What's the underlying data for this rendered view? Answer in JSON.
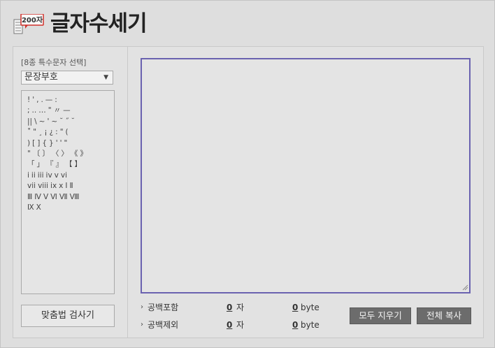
{
  "header": {
    "logo_text": "200자",
    "title": "글자수세기"
  },
  "sidebar": {
    "special_char_label": "[8종 특수문자 선택]",
    "category_select": {
      "selected": "문장부호",
      "arrow": "▼"
    },
    "char_rows": [
      [
        "!",
        "'",
        ",",
        ".",
        "—",
        ":"
      ],
      [
        ";",
        "..",
        "…",
        "\"",
        "〃",
        "—"
      ],
      [
        "||",
        "\\",
        "~",
        "'",
        "~",
        "˘",
        "˝",
        "˘"
      ],
      [
        "˚",
        "\"",
        "¸",
        "¡",
        "¿",
        ":",
        "\"",
        "("
      ],
      [
        ")",
        "[",
        "]",
        "{",
        "}",
        "'",
        "'",
        "\""
      ],
      [
        "\"",
        "〔",
        "〕",
        "〈",
        "〉",
        "《",
        "》"
      ],
      [
        "「",
        "」",
        "『",
        "』",
        "【",
        "】"
      ],
      [
        "i",
        "ii",
        "iii",
        "iv",
        "v",
        "vi"
      ],
      [
        "vii",
        "viii",
        "ix",
        "x",
        "Ⅰ",
        "Ⅱ"
      ],
      [
        "Ⅲ",
        "Ⅳ",
        "Ⅴ",
        "Ⅵ",
        "Ⅶ",
        "Ⅷ"
      ],
      [
        "Ⅸ",
        "Ⅹ"
      ]
    ],
    "spell_check_button": "맞춤법 검사기"
  },
  "editor": {
    "text": "",
    "placeholder": ""
  },
  "stats": {
    "with_spaces": {
      "label": "공백포함",
      "chars": "0",
      "char_unit": "자",
      "bytes": "0",
      "byte_unit": "byte"
    },
    "without_spaces": {
      "label": "공백제외",
      "chars": "0",
      "char_unit": "자",
      "bytes": "0",
      "byte_unit": "byte"
    },
    "chevron": "›"
  },
  "actions": {
    "clear_all": "모두 지우기",
    "copy_all": "전체 복사"
  },
  "colors": {
    "textarea_border": "#6a62b0",
    "dark_button": "#6c6c6c",
    "logo_accent": "#d0302a"
  },
  "icons": {
    "logo": "speech-bubble-doc-icon",
    "dropdown": "chevron-down-icon",
    "resize": "resize-grip-icon",
    "stat_marker": "chevron-right-icon"
  }
}
